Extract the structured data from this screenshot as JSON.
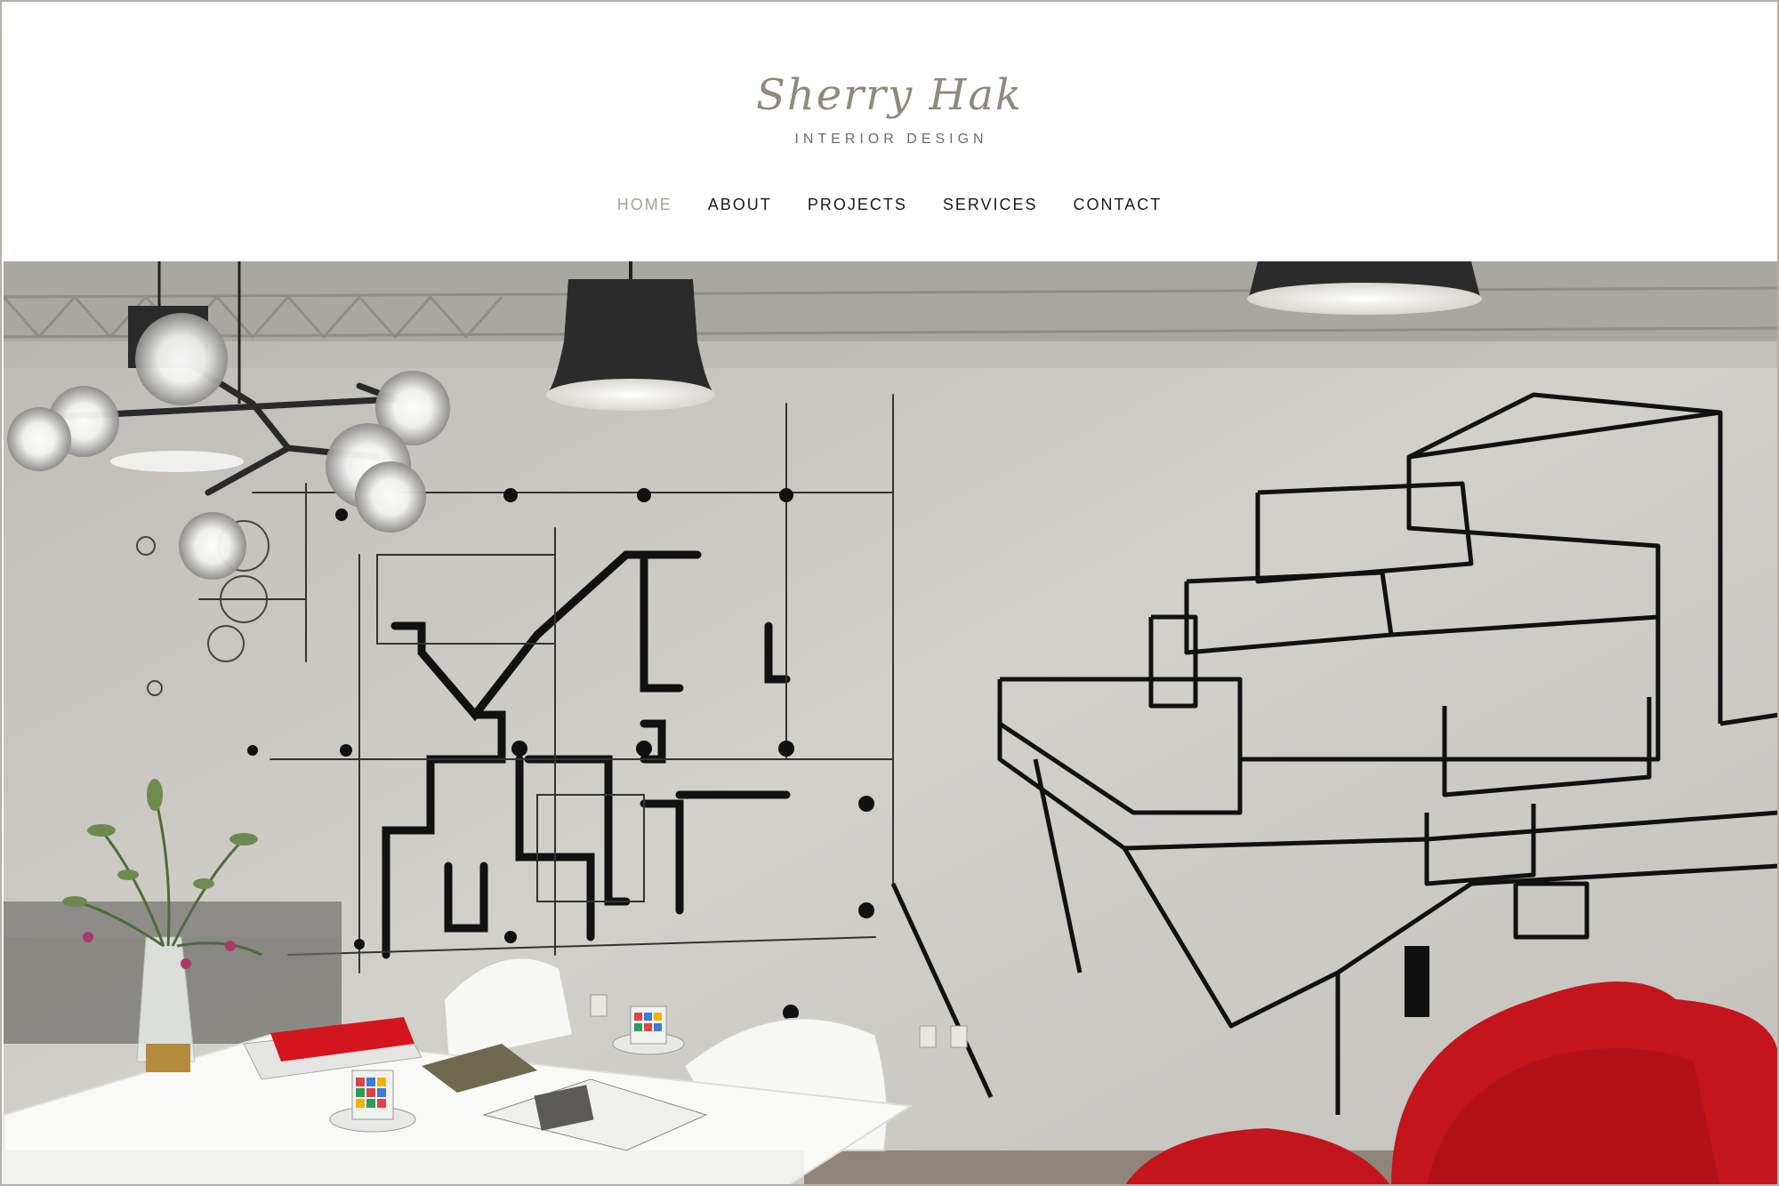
{
  "site": {
    "logo_script": "Sherry Hak",
    "logo_subtitle": "INTERIOR DESIGN"
  },
  "nav": {
    "items": [
      {
        "label": "HOME",
        "active": true
      },
      {
        "label": "ABOUT",
        "active": false
      },
      {
        "label": "PROJECTS",
        "active": false
      },
      {
        "label": "SERVICES",
        "active": false
      },
      {
        "label": "CONTACT",
        "active": false
      }
    ]
  },
  "hero": {
    "image_name": "hero-studio-image"
  },
  "colors": {
    "logo": "#8e8a7e",
    "nav_active": "#a4a097",
    "nav_text": "#1a1a1a",
    "chair_red": "#c4141c",
    "border": "#b5b0a8"
  }
}
